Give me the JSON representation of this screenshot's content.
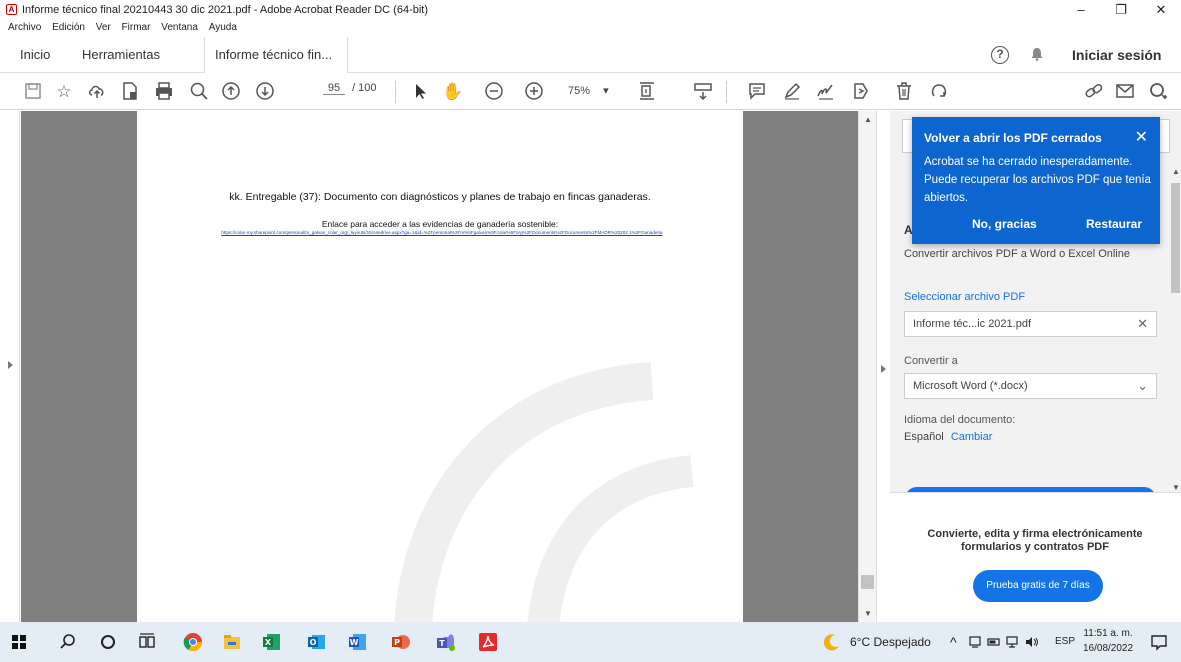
{
  "window": {
    "title": "Informe técnico final 20210443 30 dic 2021.pdf - Adobe Acrobat Reader DC (64-bit)",
    "minimize": "–",
    "restore": "❐",
    "close": "✕"
  },
  "menu": [
    "Archivo",
    "Edición",
    "Ver",
    "Firmar",
    "Ventana",
    "Ayuda"
  ],
  "tabs": {
    "home": "Inicio",
    "tools": "Herramientas",
    "document": "Informe técnico fin...",
    "document_close": "×",
    "signin": "Iniciar sesión",
    "help": "?"
  },
  "toolbar": {
    "page_current": "95",
    "page_total": "/ 100",
    "zoom": "75%",
    "zoom_caret": "▾"
  },
  "document": {
    "heading": "kk. Entregable (37): Documento con diagnósticos y planes de trabajo en fincas ganaderas.",
    "subheading": "Enlace para acceder a las evidencias de ganadería sostenible:",
    "link": "https://colar-my.sharepoint.com/personal/m_galvan_colar_org/_layouts/15/onedrive.aspx?ga=1&id=%2Fpersonal%2Fm%5Fgalvan%5Fcolar%5Forg%2FDocuments%2FDocuments%2FMADR%20202 1%2FGanaderia"
  },
  "popup": {
    "title": "Volver a abrir los PDF cerrados",
    "message": "Acrobat se ha cerrado inesperadamente. Puede recuperar los archivos PDF que tenía abiertos.",
    "dismiss": "No, gracias",
    "restore": "Restaurar",
    "close": "✕"
  },
  "right_panel": {
    "section_initial": "A",
    "description": "Convertir archivos PDF a Word o Excel Online",
    "select_file": "Seleccionar archivo PDF",
    "file_name": "Informe téc...ic 2021.pdf",
    "file_clear": "✕",
    "convert_to_label": "Convertir a",
    "convert_to_value": "Microsoft Word (*.docx)",
    "convert_caret": "⌄",
    "language_label": "Idioma del documento:",
    "language_value": "Español",
    "language_change": "Cambiar",
    "promo": "Convierte, edita y firma electrónicamente formularios y contratos PDF",
    "trial_button": "Prueba gratis de 7 días"
  },
  "taskbar": {
    "weather": "6°C  Despejado",
    "lang": "ESP",
    "time": "11:51 a. m.",
    "date": "16/08/2022"
  },
  "colors": {
    "accent": "#1473e6",
    "popup": "#0d66d0",
    "gutter": "#808080",
    "taskbar": "#e4ecf5"
  }
}
